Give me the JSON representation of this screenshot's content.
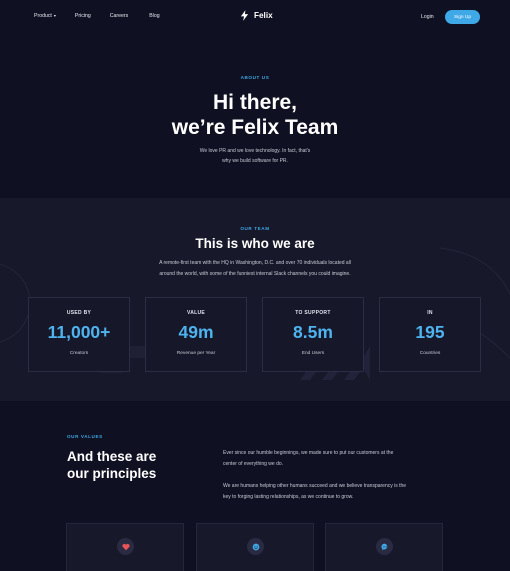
{
  "nav": {
    "items": [
      {
        "label": "Product",
        "has_dropdown": true
      },
      {
        "label": "Pricing"
      },
      {
        "label": "Careers"
      },
      {
        "label": "Blog"
      }
    ],
    "logo_text": "Felix",
    "login_label": "Login",
    "signup_label": "Sign Up"
  },
  "hero": {
    "eyebrow": "ABOUT US",
    "title_line1": "Hi there,",
    "title_line2": "we’re Felix Team",
    "desc_line1": "We love PR and we love technology. In fact, that's",
    "desc_line2": "why we build software for PR."
  },
  "team": {
    "eyebrow": "OUR TEAM",
    "title": "This is who we are",
    "desc_line1": "A remote-first team with the HQ in Washington, D.C. and over 70 individuals located all",
    "desc_line2": "around the world, with some of the funniest internal Slack channels you could imagine.",
    "stats": [
      {
        "label": "USED BY",
        "value": "11,000+",
        "sub": "Creators"
      },
      {
        "label": "VALUE",
        "value": "49m",
        "sub": "Revenue per Year"
      },
      {
        "label": "TO SUPPORT",
        "value": "8.5m",
        "sub": "End Users"
      },
      {
        "label": "IN",
        "value": "195",
        "sub": "Countries"
      }
    ]
  },
  "values": {
    "eyebrow": "OUR VALUES",
    "title_line1": "And these are",
    "title_line2": "our principles",
    "para1_line1": "Ever since our humble beginnings, we made sure to put our customers at the",
    "para1_line2": "center of everything we do.",
    "para2_line1": "We are humans helping other humans succeed and we believe transparency is the",
    "para2_line2": "key to forging lasting relationships, as we continue to grow.",
    "cards": [
      {
        "icon": "heart-icon"
      },
      {
        "icon": "smile-icon"
      },
      {
        "icon": "chat-icon"
      }
    ]
  },
  "colors": {
    "background": "#0f1021",
    "section_bg": "#171829",
    "accent": "#3fa9e8",
    "stat_value": "#4eb3ee",
    "heart": "#e8545a"
  }
}
